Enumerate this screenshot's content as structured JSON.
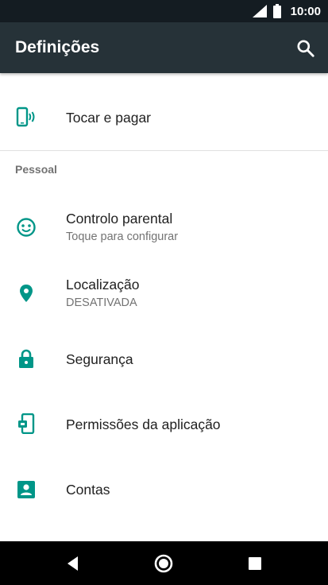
{
  "status_bar": {
    "time": "10:00",
    "signal_icon": "signal-icon",
    "battery_icon": "battery-icon"
  },
  "app_bar": {
    "title": "Definições",
    "search_icon": "search-icon"
  },
  "colors": {
    "app_bar": "#263238",
    "status_bar": "#141c22",
    "accent": "#009688",
    "nav_bar": "#000000"
  },
  "items": {
    "tap_pay": {
      "label": "Tocar e pagar",
      "icon": "tap-pay-icon"
    },
    "parental": {
      "label": "Controlo parental",
      "subtitle": "Toque para configurar",
      "icon": "parental-control-icon"
    },
    "location": {
      "label": "Localização",
      "subtitle": "DESATIVADA",
      "icon": "location-pin-icon"
    },
    "security": {
      "label": "Segurança",
      "icon": "lock-icon"
    },
    "permissions": {
      "label": "Permissões da aplicação",
      "icon": "app-permissions-icon"
    },
    "accounts": {
      "label": "Contas",
      "icon": "account-icon"
    }
  },
  "section_personal": "Pessoal",
  "nav_bar": {
    "back_icon": "back-icon",
    "home_icon": "home-icon",
    "recents_icon": "recents-icon"
  }
}
